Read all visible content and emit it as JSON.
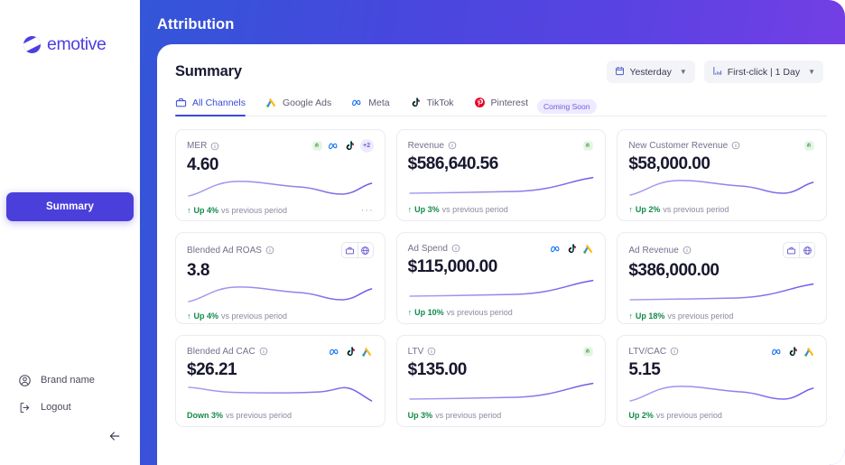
{
  "brand": {
    "name": "emotive",
    "logo_icon": "emotive-logo-icon"
  },
  "header": {
    "title": "Attribution"
  },
  "sidebar": {
    "active_item": "Summary",
    "footer": [
      {
        "label": "Brand name",
        "icon": "user-circle-icon"
      },
      {
        "label": "Logout",
        "icon": "logout-icon"
      }
    ],
    "collapse_icon": "arrow-left-icon"
  },
  "panel": {
    "title": "Summary",
    "controls": [
      {
        "id": "date-range",
        "icon": "calendar-icon",
        "label": "Yesterday",
        "caret": "▼"
      },
      {
        "id": "attribution-model",
        "icon": "bar-chart-icon",
        "label": "First-click | 1 Day",
        "caret": "▼"
      }
    ],
    "tabs": [
      {
        "id": "all-channels",
        "label": "All Channels",
        "icon": "all-channels-icon",
        "active": true
      },
      {
        "id": "google-ads",
        "label": "Google Ads",
        "icon": "google-ads-icon",
        "active": false
      },
      {
        "id": "meta",
        "label": "Meta",
        "icon": "meta-icon",
        "active": false
      },
      {
        "id": "tiktok",
        "label": "TikTok",
        "icon": "tiktok-icon",
        "active": false
      },
      {
        "id": "pinterest",
        "label": "Pinterest",
        "icon": "pinterest-icon",
        "active": false,
        "badge": "Coming Soon"
      }
    ]
  },
  "cards": [
    {
      "label": "MER",
      "value": "4.60",
      "delta_arrow": "↑",
      "delta": "Up 4%",
      "delta_suffix": "vs previous period",
      "chips": [
        "shopify",
        "meta",
        "tiktok"
      ],
      "chip_more": "+2",
      "chip_style": "round",
      "has_menu": true,
      "spark": "wave"
    },
    {
      "label": "Revenue",
      "value": "$586,640.56",
      "delta_arrow": "↑",
      "delta": "Up 3%",
      "delta_suffix": "vs previous period",
      "chips": [
        "shopify"
      ],
      "chip_style": "round",
      "has_menu": false,
      "spark": "rise"
    },
    {
      "label": "New Customer Revenue",
      "value": "$58,000.00",
      "delta_arrow": "↑",
      "delta": "Up 2%",
      "delta_suffix": "vs previous period",
      "chips": [
        "shopify"
      ],
      "chip_style": "round",
      "has_menu": false,
      "spark": "wave"
    },
    {
      "label": "Blended Ad ROAS",
      "value": "3.8",
      "delta_arrow": "↑",
      "delta": "Up 4%",
      "delta_suffix": "vs previous period",
      "chips": [
        "bag",
        "globe"
      ],
      "chip_style": "group",
      "has_menu": false,
      "spark": "wave"
    },
    {
      "label": "Ad Spend",
      "value": "$115,000.00",
      "delta_arrow": "↑",
      "delta": "Up 10%",
      "delta_suffix": "vs previous period",
      "chips": [
        "meta",
        "tiktok",
        "google"
      ],
      "chip_style": "round",
      "has_menu": false,
      "spark": "rise"
    },
    {
      "label": "Ad Revenue",
      "value": "$386,000.00",
      "delta_arrow": "↑",
      "delta": "Up 18%",
      "delta_suffix": "vs previous period",
      "chips": [
        "bag",
        "globe"
      ],
      "chip_style": "group",
      "has_menu": false,
      "spark": "rise"
    },
    {
      "label": "Blended Ad CAC",
      "value": "$26.21",
      "delta_arrow": "",
      "delta": "Down 3%",
      "delta_suffix": "vs previous period",
      "chips": [
        "meta",
        "tiktok",
        "google"
      ],
      "chip_style": "round",
      "has_menu": false,
      "spark": "fall"
    },
    {
      "label": "LTV",
      "value": "$135.00",
      "delta_arrow": "",
      "delta": "Up 3%",
      "delta_suffix": "vs previous period",
      "chips": [
        "shopify"
      ],
      "chip_style": "round",
      "has_menu": false,
      "spark": "rise"
    },
    {
      "label": "LTV/CAC",
      "value": "5.15",
      "delta_arrow": "",
      "delta": "Up 2%",
      "delta_suffix": "vs previous period",
      "chips": [
        "meta",
        "tiktok",
        "google"
      ],
      "chip_style": "round",
      "has_menu": false,
      "spark": "wave"
    }
  ],
  "colors": {
    "brand_purple": "#4c3fe0",
    "header_gradient_start": "#3356d8",
    "header_gradient_end": "#7b3ee6",
    "positive_green": "#138a4a",
    "spark_line": "#6c5ce7",
    "tab_active": "#3b49d8"
  },
  "icon_glyphs": {
    "menu_dots": "···",
    "collapse": "←"
  }
}
